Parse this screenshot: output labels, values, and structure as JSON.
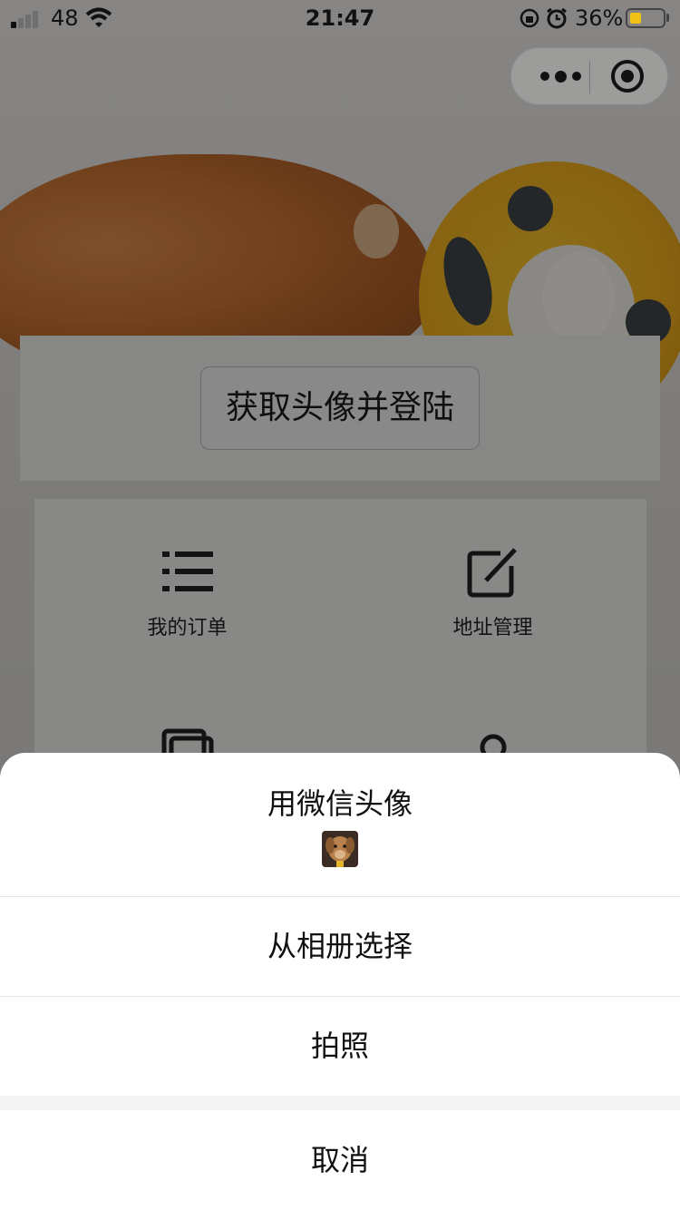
{
  "status_bar": {
    "network": "48",
    "time": "21:47",
    "battery_percent": "36%",
    "battery_level": 0.36,
    "battery_color": "#f2c118"
  },
  "capsule": {
    "more_icon": "more-dots-icon",
    "close_icon": "target-icon"
  },
  "page": {
    "login_button": "获取头像并登陆",
    "menu_items": [
      {
        "label": "我的订单",
        "icon": "list-icon"
      },
      {
        "label": "地址管理",
        "icon": "edit-square-icon"
      }
    ],
    "partially_hidden_icons": [
      "cards-icon",
      "location-icon"
    ]
  },
  "action_sheet": {
    "use_wechat_avatar": "用微信头像",
    "choose_from_album": "从相册选择",
    "take_photo": "拍照",
    "cancel": "取消"
  },
  "colors": {
    "overlay": "rgba(0,0,0,0.42)",
    "sheet_bg": "#ffffff",
    "separator": "#f4f4f4"
  }
}
